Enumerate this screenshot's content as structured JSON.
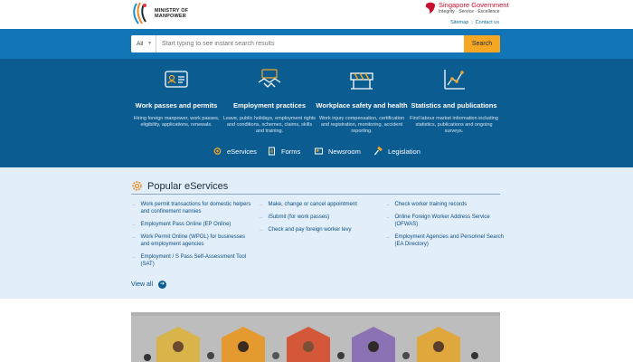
{
  "header": {
    "logo_lines": [
      "MINISTRY OF",
      "MANPOWER"
    ],
    "gov_title_a": "Singapore ",
    "gov_title_b": "Government",
    "gov_tagline": "Integrity · Service · Excellence",
    "links": [
      "Sitemap",
      "Contact us"
    ]
  },
  "search": {
    "scope": "All",
    "placeholder": "Start typing to see instant search results",
    "button": "Search"
  },
  "services": [
    {
      "title": "Work passes and permits",
      "desc": "Hiring foreign manpower, work passes, eligibility, applications, renewals.",
      "icon": "id-card-icon"
    },
    {
      "title": "Employment practices",
      "desc": "Leave, public holidays, employment rights and conditions, schemes, claims, skills and training.",
      "icon": "handshake-icon"
    },
    {
      "title": "Workplace safety and health",
      "desc": "Work injury compensation, certification and registration, monitoring, accident reporting.",
      "icon": "barrier-icon"
    },
    {
      "title": "Statistics and publications",
      "desc": "Find labour market information including statistics, publications and ongoing surveys.",
      "icon": "chart-icon"
    }
  ],
  "quicklinks": [
    {
      "label": "eServices",
      "icon": "gear-icon"
    },
    {
      "label": "Forms",
      "icon": "document-icon"
    },
    {
      "label": "Newsroom",
      "icon": "newspaper-icon"
    },
    {
      "label": "Legislation",
      "icon": "gavel-icon"
    }
  ],
  "popular": {
    "title": "Popular eServices",
    "columns": [
      [
        "Work permit transactions for domestic helpers and confinement nannies",
        "Employment Pass Online (EP Online)",
        "Work Permit Online (WPOL) for businesses and employment agencies",
        "Employment / S Pass Self-Assessment Tool (SAT)"
      ],
      [
        "Make, change or cancel appointment",
        "iSubmit (for work passes)",
        "Check and pay foreign worker levy"
      ],
      [
        "Check worker training records",
        "Online Foreign Worker Address Service (OFWAS)",
        "Employment Agencies and Personnel Search (EA Directory)"
      ]
    ],
    "view_all": "View all"
  },
  "colors": {
    "search_band": "#1275b5",
    "services_band": "#0b5c90",
    "popular_bg": "#e2eef9",
    "accent": "#f5a623",
    "gov_red": "#c8102e"
  }
}
